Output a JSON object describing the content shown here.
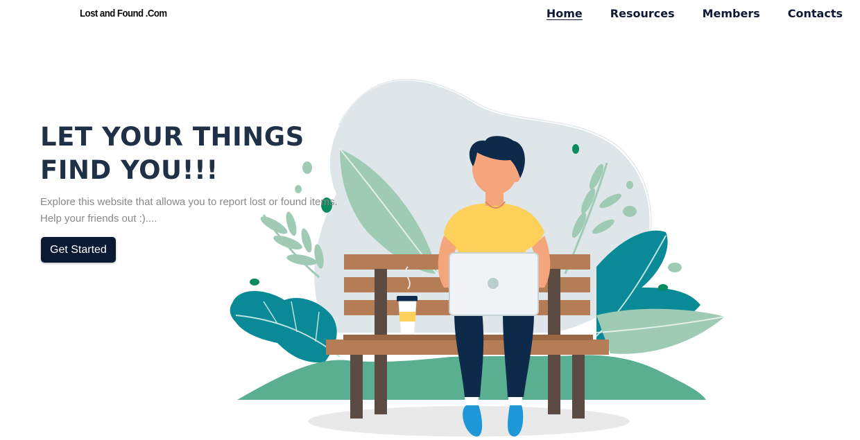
{
  "header": {
    "logo": "Lost and Found .Com",
    "nav": [
      {
        "label": "Home",
        "active": true
      },
      {
        "label": "Resources",
        "active": false
      },
      {
        "label": "Members",
        "active": false
      },
      {
        "label": "Contacts",
        "active": false
      }
    ]
  },
  "hero": {
    "title_line1": "LET YOUR THINGS",
    "title_line2": "FIND YOU!!!",
    "subtitle_line1": "Explore this website that allowa you to report lost or found items.",
    "subtitle_line2": "Help your friends out :)....",
    "cta_label": "Get Started"
  },
  "colors": {
    "navy": "#0a1a33",
    "heading": "#1f3047",
    "teal": "#0a8a96",
    "sage": "#9fcbb5",
    "bench": "#b57d56",
    "shirt": "#fdd05a"
  }
}
